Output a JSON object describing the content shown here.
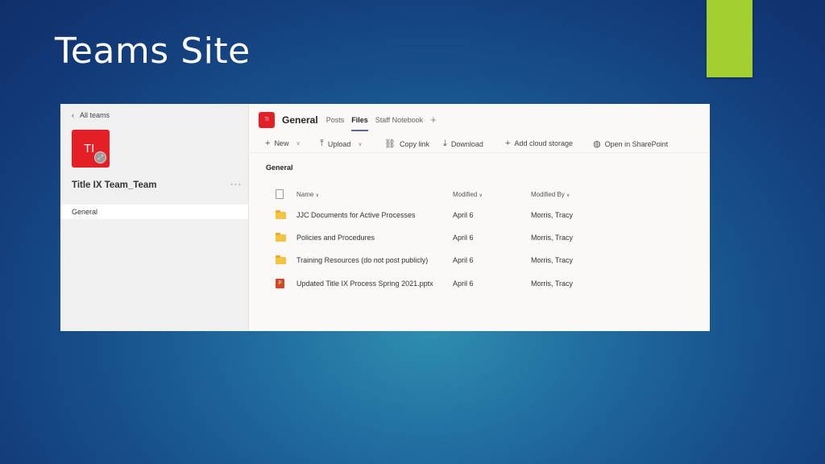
{
  "slide": {
    "title": "Teams Site"
  },
  "colors": {
    "accent": "#a4cf30",
    "team_red": "#e41f26",
    "tab_underline": "#6264a7"
  },
  "sidebar": {
    "back_label": "All teams",
    "avatar_initials": "TI",
    "team_name": "Title IX Team_Team",
    "more": "···",
    "channels": [
      {
        "label": "General"
      }
    ]
  },
  "header": {
    "avatar_initials": "TI",
    "channel_title": "General",
    "tabs": [
      {
        "label": "Posts"
      },
      {
        "label": "Files"
      },
      {
        "label": "Staff Notebook"
      }
    ],
    "add_tab": "+"
  },
  "toolbar": {
    "new": "New",
    "upload": "Upload",
    "copy_link": "Copy link",
    "download": "Download",
    "add_cloud": "Add cloud storage",
    "open_sharepoint": "Open in SharePoint"
  },
  "breadcrumb": "General",
  "table": {
    "columns": {
      "name": "Name",
      "modified": "Modified",
      "modified_by": "Modified By"
    },
    "rows": [
      {
        "type": "folder",
        "name": "JJC Documents for Active Processes",
        "modified": "April 6",
        "modified_by": "Morris, Tracy"
      },
      {
        "type": "folder",
        "name": "Policies and Procedures",
        "modified": "April 6",
        "modified_by": "Morris, Tracy"
      },
      {
        "type": "folder",
        "name": "Training Resources (do not post publicly)",
        "modified": "April 6",
        "modified_by": "Morris, Tracy"
      },
      {
        "type": "pptx",
        "name": "Updated Title IX Process Spring 2021.pptx",
        "modified": "April 6",
        "modified_by": "Morris, Tracy"
      }
    ]
  }
}
